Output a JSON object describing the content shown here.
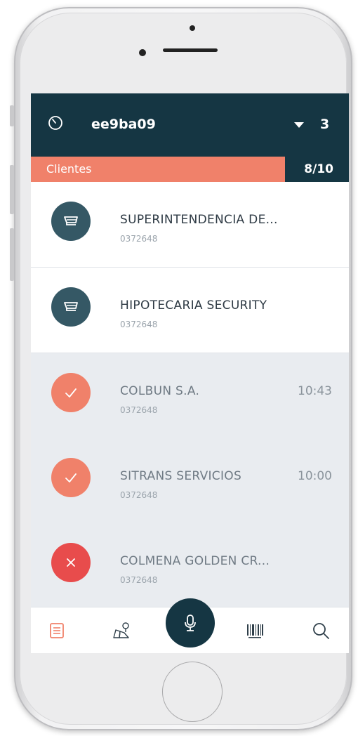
{
  "header": {
    "route_id": "ee9ba09",
    "count": "3"
  },
  "progress": {
    "label": "Clientes",
    "count": "8/10",
    "fraction": 0.8
  },
  "clients": [
    {
      "name": "SUPERINTENDENCIA DE...",
      "code": "0372648",
      "time": "",
      "status": "pending"
    },
    {
      "name": "HIPOTECARIA SECURITY",
      "code": "0372648",
      "time": "",
      "status": "pending"
    },
    {
      "name": "COLBUN S.A.",
      "code": "0372648",
      "time": "10:43",
      "status": "done"
    },
    {
      "name": "SITRANS SERVICIOS",
      "code": "0372648",
      "time": "10:00",
      "status": "done"
    },
    {
      "name": "COLMENA GOLDEN CR...",
      "code": "0372648",
      "time": "",
      "status": "failed"
    }
  ],
  "tabbar": {
    "tabs": [
      "list-icon",
      "map-pin-icon",
      "microphone-icon",
      "barcode-icon",
      "search-icon"
    ],
    "active": "list-icon"
  },
  "colors": {
    "primary": "#153643",
    "accent": "#f0816a",
    "failed": "#e84c4c",
    "pending_avatar": "#355865"
  }
}
